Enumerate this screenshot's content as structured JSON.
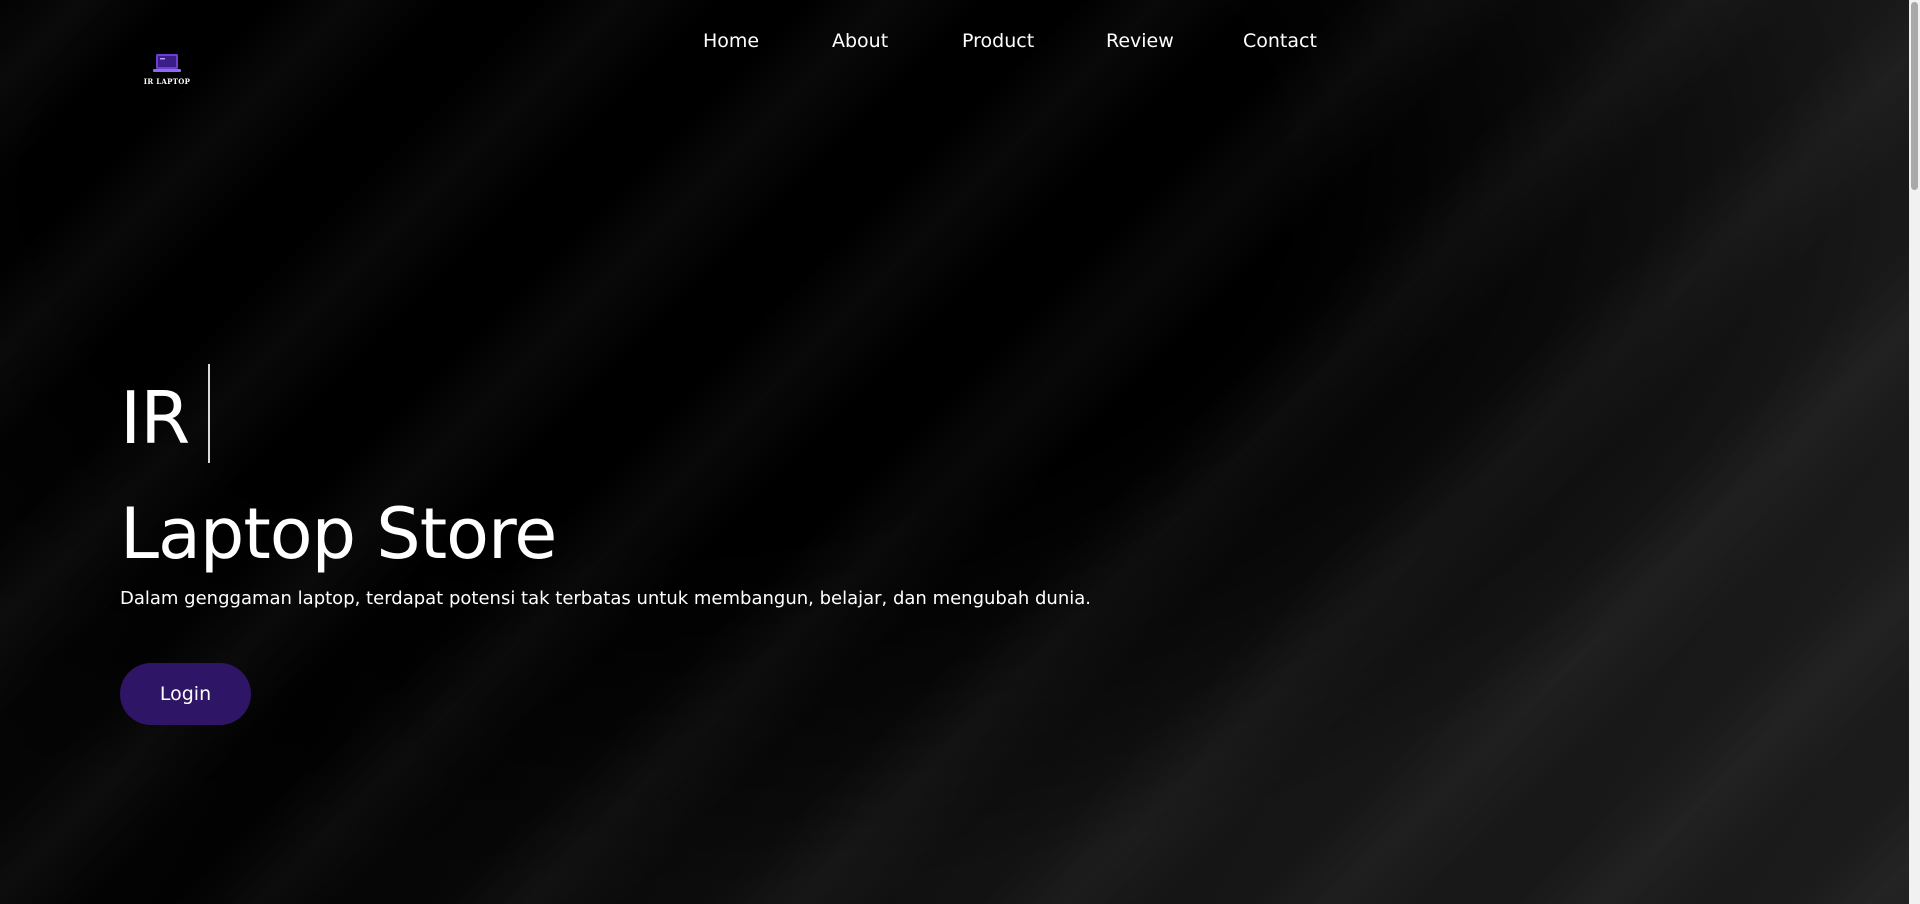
{
  "brand": {
    "name": "IR LAPTOP",
    "tagline_small": "· · · · · · · ·",
    "colors": {
      "accent": "#2f1566",
      "logo_purple": "#6b3fd1"
    },
    "icon": "laptop-icon"
  },
  "nav": {
    "items": [
      {
        "label": "Home"
      },
      {
        "label": "About"
      },
      {
        "label": "Product"
      },
      {
        "label": "Review"
      },
      {
        "label": "Contact"
      }
    ]
  },
  "hero": {
    "typed_text": "IR",
    "title": "Laptop Store",
    "subtitle": "Dalam genggaman laptop, terdapat potensi tak terbatas untuk membangun, belajar, dan mengubah dunia.",
    "login_label": "Login"
  }
}
